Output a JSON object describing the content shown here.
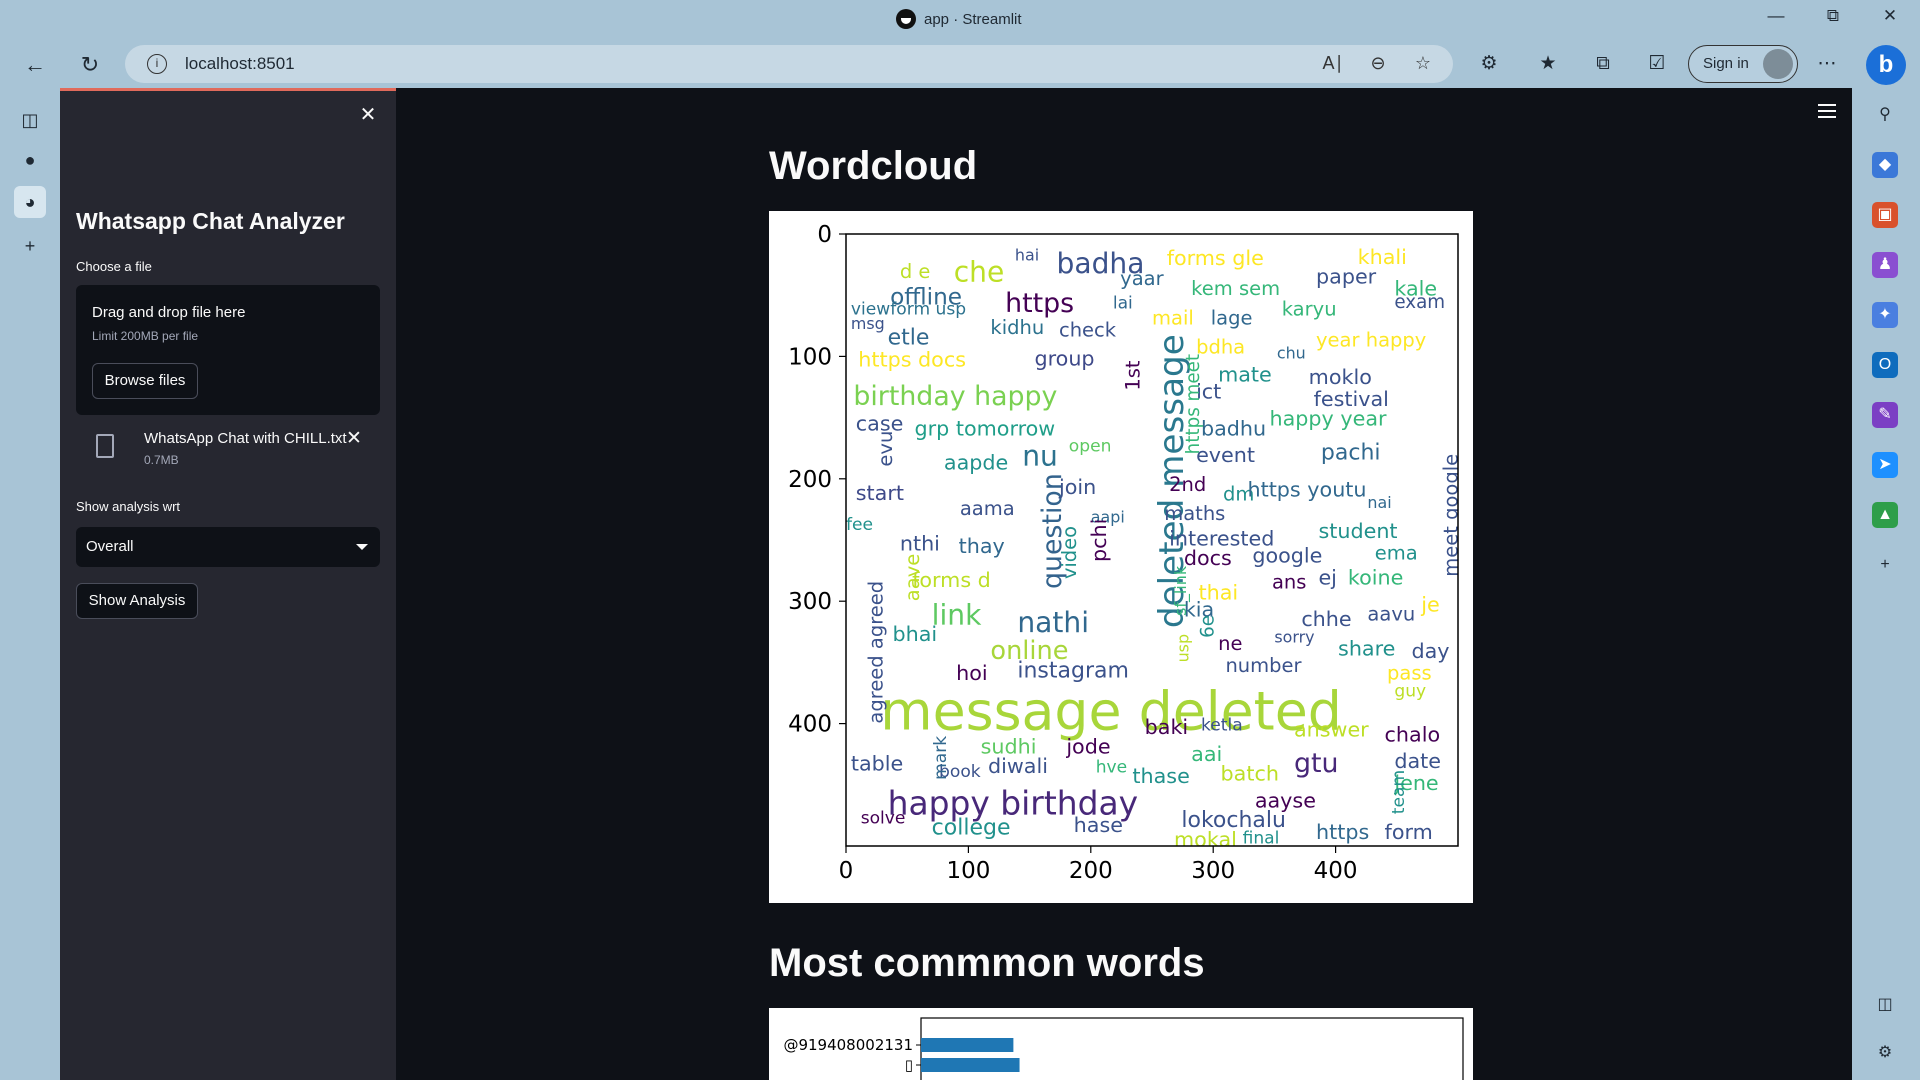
{
  "browser": {
    "title": "app · Streamlit",
    "url": "localhost:8501",
    "signin": "Sign in"
  },
  "sidebar": {
    "title": "Whatsapp Chat Analyzer",
    "choose_label": "Choose a file",
    "dropzone_title": "Drag and drop file here",
    "dropzone_limit": "Limit 200MB per file",
    "browse_label": "Browse files",
    "file_name": "WhatsApp Chat with CHILL.txt",
    "file_size": "0.7MB",
    "analysis_label": "Show analysis wrt",
    "analysis_value": "Overall",
    "show_button": "Show Analysis"
  },
  "main": {
    "wordcloud_heading": "Wordcloud",
    "common_heading": "Most commmon words"
  },
  "chart_data": [
    {
      "type": "other",
      "title": "",
      "xlim": [
        0,
        500
      ],
      "ylim": [
        500,
        0
      ],
      "x_ticks": [
        "0",
        "100",
        "200",
        "300",
        "400"
      ],
      "y_ticks": [
        "0",
        "100",
        "200",
        "300",
        "400"
      ],
      "words": [
        {
          "text": "message deleted",
          "x": 28,
          "y": 372,
          "s": 44,
          "c": "#a8d63a"
        },
        {
          "text": "happy birthday",
          "x": 34,
          "y": 454,
          "s": 27,
          "c": "#482879"
        },
        {
          "text": "birthday happy",
          "x": 6,
          "y": 124,
          "s": 22,
          "c": "#7ad151"
        },
        {
          "text": "deleted message",
          "x": 255,
          "y": 322,
          "s": 28,
          "c": "#2a788e",
          "r": -90
        },
        {
          "text": "question",
          "x": 160,
          "y": 290,
          "s": 22,
          "c": "#33638d",
          "r": -90
        },
        {
          "text": "badha",
          "x": 172,
          "y": 15,
          "s": 23,
          "c": "#3b528b"
        },
        {
          "text": "https",
          "x": 130,
          "y": 48,
          "s": 22,
          "c": "#440154"
        },
        {
          "text": "che",
          "x": 88,
          "y": 22,
          "s": 23,
          "c": "#bddf26"
        },
        {
          "text": "offline",
          "x": 36,
          "y": 44,
          "s": 19,
          "c": "#31688e"
        },
        {
          "text": "forms gle",
          "x": 262,
          "y": 13,
          "s": 17,
          "c": "#fde725"
        },
        {
          "text": "khali",
          "x": 418,
          "y": 12,
          "s": 17,
          "c": "#fde725"
        },
        {
          "text": "paper",
          "x": 384,
          "y": 28,
          "s": 17,
          "c": "#3b528b"
        },
        {
          "text": "kale",
          "x": 448,
          "y": 38,
          "s": 17,
          "c": "#35b779"
        },
        {
          "text": "exam",
          "x": 448,
          "y": 50,
          "s": 15,
          "c": "#3b528b"
        },
        {
          "text": "nathi",
          "x": 140,
          "y": 308,
          "s": 23,
          "c": "#31688e"
        },
        {
          "text": "link",
          "x": 70,
          "y": 302,
          "s": 23,
          "c": "#5ec962"
        },
        {
          "text": "online",
          "x": 118,
          "y": 332,
          "s": 21,
          "c": "#a8d63a"
        },
        {
          "text": "instagram",
          "x": 140,
          "y": 350,
          "s": 18,
          "c": "#3b528b"
        },
        {
          "text": "nu",
          "x": 144,
          "y": 172,
          "s": 23,
          "c": "#2c728e"
        },
        {
          "text": "https docs",
          "x": 10,
          "y": 96,
          "s": 17,
          "c": "#fde725"
        },
        {
          "text": "group",
          "x": 154,
          "y": 95,
          "s": 17,
          "c": "#3e4989"
        },
        {
          "text": "grp tomorrow",
          "x": 56,
          "y": 152,
          "s": 17,
          "c": "#1f9e89"
        },
        {
          "text": "case",
          "x": 8,
          "y": 148,
          "s": 17,
          "c": "#3b528b"
        },
        {
          "text": "aapde",
          "x": 80,
          "y": 180,
          "s": 17,
          "c": "#21918c"
        },
        {
          "text": "start",
          "x": 8,
          "y": 205,
          "s": 17,
          "c": "#3e4989"
        },
        {
          "text": "aama",
          "x": 93,
          "y": 218,
          "s": 16,
          "c": "#3b528b"
        },
        {
          "text": "join",
          "x": 174,
          "y": 200,
          "s": 17,
          "c": "#3b528b"
        },
        {
          "text": "thay",
          "x": 92,
          "y": 248,
          "s": 17,
          "c": "#31688e"
        },
        {
          "text": "nthi",
          "x": 44,
          "y": 246,
          "s": 17,
          "c": "#3b528b"
        },
        {
          "text": "forms d",
          "x": 54,
          "y": 276,
          "s": 17,
          "c": "#bddf26"
        },
        {
          "text": "bhai",
          "x": 38,
          "y": 320,
          "s": 17,
          "c": "#21918c"
        },
        {
          "text": "hoi",
          "x": 90,
          "y": 352,
          "s": 17,
          "c": "#440154"
        },
        {
          "text": "etle",
          "x": 34,
          "y": 78,
          "s": 18,
          "c": "#31688e"
        },
        {
          "text": "kidhu",
          "x": 118,
          "y": 70,
          "s": 16,
          "c": "#2c728e"
        },
        {
          "text": "check",
          "x": 174,
          "y": 72,
          "s": 16,
          "c": "#3b528b"
        },
        {
          "text": "yaar",
          "x": 224,
          "y": 30,
          "s": 16,
          "c": "#31688e"
        },
        {
          "text": "lai",
          "x": 218,
          "y": 51,
          "s": 14,
          "c": "#31688e"
        },
        {
          "text": "kem sem",
          "x": 282,
          "y": 38,
          "s": 16,
          "c": "#35b779"
        },
        {
          "text": "mail",
          "x": 250,
          "y": 62,
          "s": 16,
          "c": "#fde725"
        },
        {
          "text": "lage",
          "x": 298,
          "y": 62,
          "s": 16,
          "c": "#31688e"
        },
        {
          "text": "karyu",
          "x": 356,
          "y": 55,
          "s": 16,
          "c": "#35b779"
        },
        {
          "text": "year happy",
          "x": 384,
          "y": 80,
          "s": 16,
          "c": "#fde725"
        },
        {
          "text": "bdha",
          "x": 286,
          "y": 86,
          "s": 16,
          "c": "#fde725"
        },
        {
          "text": "chu",
          "x": 352,
          "y": 92,
          "s": 13,
          "c": "#31688e"
        },
        {
          "text": "mate",
          "x": 304,
          "y": 108,
          "s": 17,
          "c": "#21918c"
        },
        {
          "text": "moklo",
          "x": 378,
          "y": 110,
          "s": 17,
          "c": "#3b528b"
        },
        {
          "text": "ict",
          "x": 286,
          "y": 122,
          "s": 17,
          "c": "#3b528b"
        },
        {
          "text": "festival",
          "x": 382,
          "y": 128,
          "s": 17,
          "c": "#3b528b"
        },
        {
          "text": "happy year",
          "x": 346,
          "y": 144,
          "s": 17,
          "c": "#35b779"
        },
        {
          "text": "badhu",
          "x": 290,
          "y": 152,
          "s": 17,
          "c": "#31688e"
        },
        {
          "text": "event",
          "x": 286,
          "y": 174,
          "s": 17,
          "c": "#3b528b"
        },
        {
          "text": "pachi",
          "x": 388,
          "y": 172,
          "s": 18,
          "c": "#31688e"
        },
        {
          "text": "2nd",
          "x": 264,
          "y": 198,
          "s": 16,
          "c": "#440154"
        },
        {
          "text": "dm",
          "x": 308,
          "y": 206,
          "s": 16,
          "c": "#21918c"
        },
        {
          "text": "https youtu",
          "x": 328,
          "y": 202,
          "s": 17,
          "c": "#31688e"
        },
        {
          "text": "maths",
          "x": 260,
          "y": 222,
          "s": 16,
          "c": "#3b528b"
        },
        {
          "text": "nai",
          "x": 426,
          "y": 214,
          "s": 13,
          "c": "#31688e"
        },
        {
          "text": "interested",
          "x": 264,
          "y": 242,
          "s": 17,
          "c": "#3b528b"
        },
        {
          "text": "student",
          "x": 386,
          "y": 236,
          "s": 17,
          "c": "#21918c"
        },
        {
          "text": "docs",
          "x": 276,
          "y": 258,
          "s": 17,
          "c": "#440154"
        },
        {
          "text": "google",
          "x": 332,
          "y": 256,
          "s": 17,
          "c": "#3b528b"
        },
        {
          "text": "ema",
          "x": 432,
          "y": 254,
          "s": 16,
          "c": "#21918c"
        },
        {
          "text": "ans",
          "x": 348,
          "y": 278,
          "s": 16,
          "c": "#440154"
        },
        {
          "text": "ej",
          "x": 386,
          "y": 274,
          "s": 17,
          "c": "#3b528b"
        },
        {
          "text": "koine",
          "x": 410,
          "y": 274,
          "s": 17,
          "c": "#35b779"
        },
        {
          "text": "thai",
          "x": 288,
          "y": 286,
          "s": 17,
          "c": "#fde725"
        },
        {
          "text": "kia",
          "x": 276,
          "y": 300,
          "s": 17,
          "c": "#31688e"
        },
        {
          "text": "chhe",
          "x": 372,
          "y": 308,
          "s": 17,
          "c": "#3b528b"
        },
        {
          "text": "aavu",
          "x": 426,
          "y": 304,
          "s": 16,
          "c": "#3b528b"
        },
        {
          "text": "je",
          "x": 470,
          "y": 296,
          "s": 17,
          "c": "#fde725"
        },
        {
          "text": "ne",
          "x": 304,
          "y": 328,
          "s": 16,
          "c": "#440154"
        },
        {
          "text": "sorry",
          "x": 350,
          "y": 324,
          "s": 13,
          "c": "#3b528b"
        },
        {
          "text": "share",
          "x": 402,
          "y": 332,
          "s": 17,
          "c": "#21918c"
        },
        {
          "text": "day",
          "x": 462,
          "y": 334,
          "s": 17,
          "c": "#3b528b"
        },
        {
          "text": "number",
          "x": 310,
          "y": 346,
          "s": 16,
          "c": "#3b528b"
        },
        {
          "text": "pass",
          "x": 442,
          "y": 352,
          "s": 16,
          "c": "#fde725"
        },
        {
          "text": "guy",
          "x": 448,
          "y": 368,
          "s": 14,
          "c": "#bddf26"
        },
        {
          "text": "baki",
          "x": 244,
          "y": 396,
          "s": 17,
          "c": "#440154"
        },
        {
          "text": "ketla",
          "x": 290,
          "y": 396,
          "s": 14,
          "c": "#3b528b"
        },
        {
          "text": "answer",
          "x": 366,
          "y": 398,
          "s": 17,
          "c": "#bddf26"
        },
        {
          "text": "chalo",
          "x": 440,
          "y": 402,
          "s": 17,
          "c": "#440154"
        },
        {
          "text": "aai",
          "x": 282,
          "y": 418,
          "s": 17,
          "c": "#35b779"
        },
        {
          "text": "gtu",
          "x": 366,
          "y": 424,
          "s": 22,
          "c": "#482879"
        },
        {
          "text": "date",
          "x": 448,
          "y": 424,
          "s": 17,
          "c": "#3b528b"
        },
        {
          "text": "jene",
          "x": 448,
          "y": 442,
          "s": 17,
          "c": "#35b779"
        },
        {
          "text": "batch",
          "x": 306,
          "y": 434,
          "s": 17,
          "c": "#bddf26"
        },
        {
          "text": "thase",
          "x": 234,
          "y": 436,
          "s": 17,
          "c": "#21918c"
        },
        {
          "text": "sudhi",
          "x": 110,
          "y": 412,
          "s": 17,
          "c": "#5ec962"
        },
        {
          "text": "jode",
          "x": 180,
          "y": 412,
          "s": 17,
          "c": "#440154"
        },
        {
          "text": "diwali",
          "x": 116,
          "y": 428,
          "s": 17,
          "c": "#3b528b"
        },
        {
          "text": "hve",
          "x": 204,
          "y": 430,
          "s": 14,
          "c": "#35b779"
        },
        {
          "text": "book",
          "x": 76,
          "y": 434,
          "s": 14,
          "c": "#3b528b"
        },
        {
          "text": "table",
          "x": 4,
          "y": 426,
          "s": 17,
          "c": "#3b528b"
        },
        {
          "text": "solve",
          "x": 12,
          "y": 472,
          "s": 14,
          "c": "#440154"
        },
        {
          "text": "college",
          "x": 70,
          "y": 478,
          "s": 18,
          "c": "#21918c"
        },
        {
          "text": "hase",
          "x": 186,
          "y": 476,
          "s": 17,
          "c": "#3b528b"
        },
        {
          "text": "aayse",
          "x": 334,
          "y": 456,
          "s": 17,
          "c": "#440154"
        },
        {
          "text": "lokochalu",
          "x": 274,
          "y": 472,
          "s": 18,
          "c": "#3b528b"
        },
        {
          "text": "mokal",
          "x": 268,
          "y": 488,
          "s": 17,
          "c": "#bddf26"
        },
        {
          "text": "final",
          "x": 324,
          "y": 488,
          "s": 14,
          "c": "#21918c"
        },
        {
          "text": "https",
          "x": 384,
          "y": 482,
          "s": 17,
          "c": "#31688e"
        },
        {
          "text": "form",
          "x": 440,
          "y": 482,
          "s": 17,
          "c": "#3b528b"
        },
        {
          "text": "open",
          "x": 182,
          "y": 168,
          "s": 14,
          "c": "#5ec962"
        },
        {
          "text": "aapi",
          "x": 200,
          "y": 226,
          "s": 13,
          "c": "#31688e"
        },
        {
          "text": "fee",
          "x": 0,
          "y": 232,
          "s": 14,
          "c": "#21918c"
        },
        {
          "text": "hai",
          "x": 138,
          "y": 12,
          "s": 13,
          "c": "#3b528b"
        },
        {
          "text": "d e",
          "x": 44,
          "y": 24,
          "s": 16,
          "c": "#bddf26"
        },
        {
          "text": "viewform usp",
          "x": 4,
          "y": 56,
          "s": 14,
          "c": "#2c728e"
        },
        {
          "text": "msg",
          "x": 4,
          "y": 68,
          "s": 13,
          "c": "#3b528b"
        },
        {
          "text": "video",
          "x": 176,
          "y": 282,
          "s": 16,
          "c": "#21918c",
          "r": -90
        },
        {
          "text": "pchi",
          "x": 200,
          "y": 268,
          "s": 17,
          "c": "#440154",
          "r": -90
        },
        {
          "text": "agreed agreed",
          "x": 18,
          "y": 400,
          "s": 16,
          "c": "#3b528b",
          "r": -90
        },
        {
          "text": "aave",
          "x": 48,
          "y": 300,
          "s": 16,
          "c": "#bddf26",
          "r": -90
        },
        {
          "text": "evu",
          "x": 26,
          "y": 190,
          "s": 16,
          "c": "#3b528b",
          "r": -90
        },
        {
          "text": "1st",
          "x": 228,
          "y": 128,
          "s": 16,
          "c": "#440154",
          "r": -90
        },
        {
          "text": "https meet",
          "x": 278,
          "y": 180,
          "s": 15,
          "c": "#35b779",
          "r": -90
        },
        {
          "text": "meet google",
          "x": 488,
          "y": 280,
          "s": 16,
          "c": "#3b528b",
          "r": -90
        },
        {
          "text": "sf_link",
          "x": 268,
          "y": 312,
          "s": 13,
          "c": "#35b779",
          "r": -90
        },
        {
          "text": "usp",
          "x": 270,
          "y": 350,
          "s": 13,
          "c": "#bddf26",
          "r": -90
        },
        {
          "text": "6e",
          "x": 290,
          "y": 330,
          "s": 15,
          "c": "#21918c",
          "r": -90
        },
        {
          "text": "mark",
          "x": 72,
          "y": 446,
          "s": 14,
          "c": "#31688e",
          "r": -90
        },
        {
          "text": "team",
          "x": 446,
          "y": 474,
          "s": 14,
          "c": "#21918c",
          "r": -90
        }
      ]
    },
    {
      "type": "bar",
      "title": "",
      "categories": [
        "@919408002131",
        "▯"
      ],
      "values": [
        75,
        80
      ],
      "xlim": [
        0,
        440
      ]
    }
  ]
}
